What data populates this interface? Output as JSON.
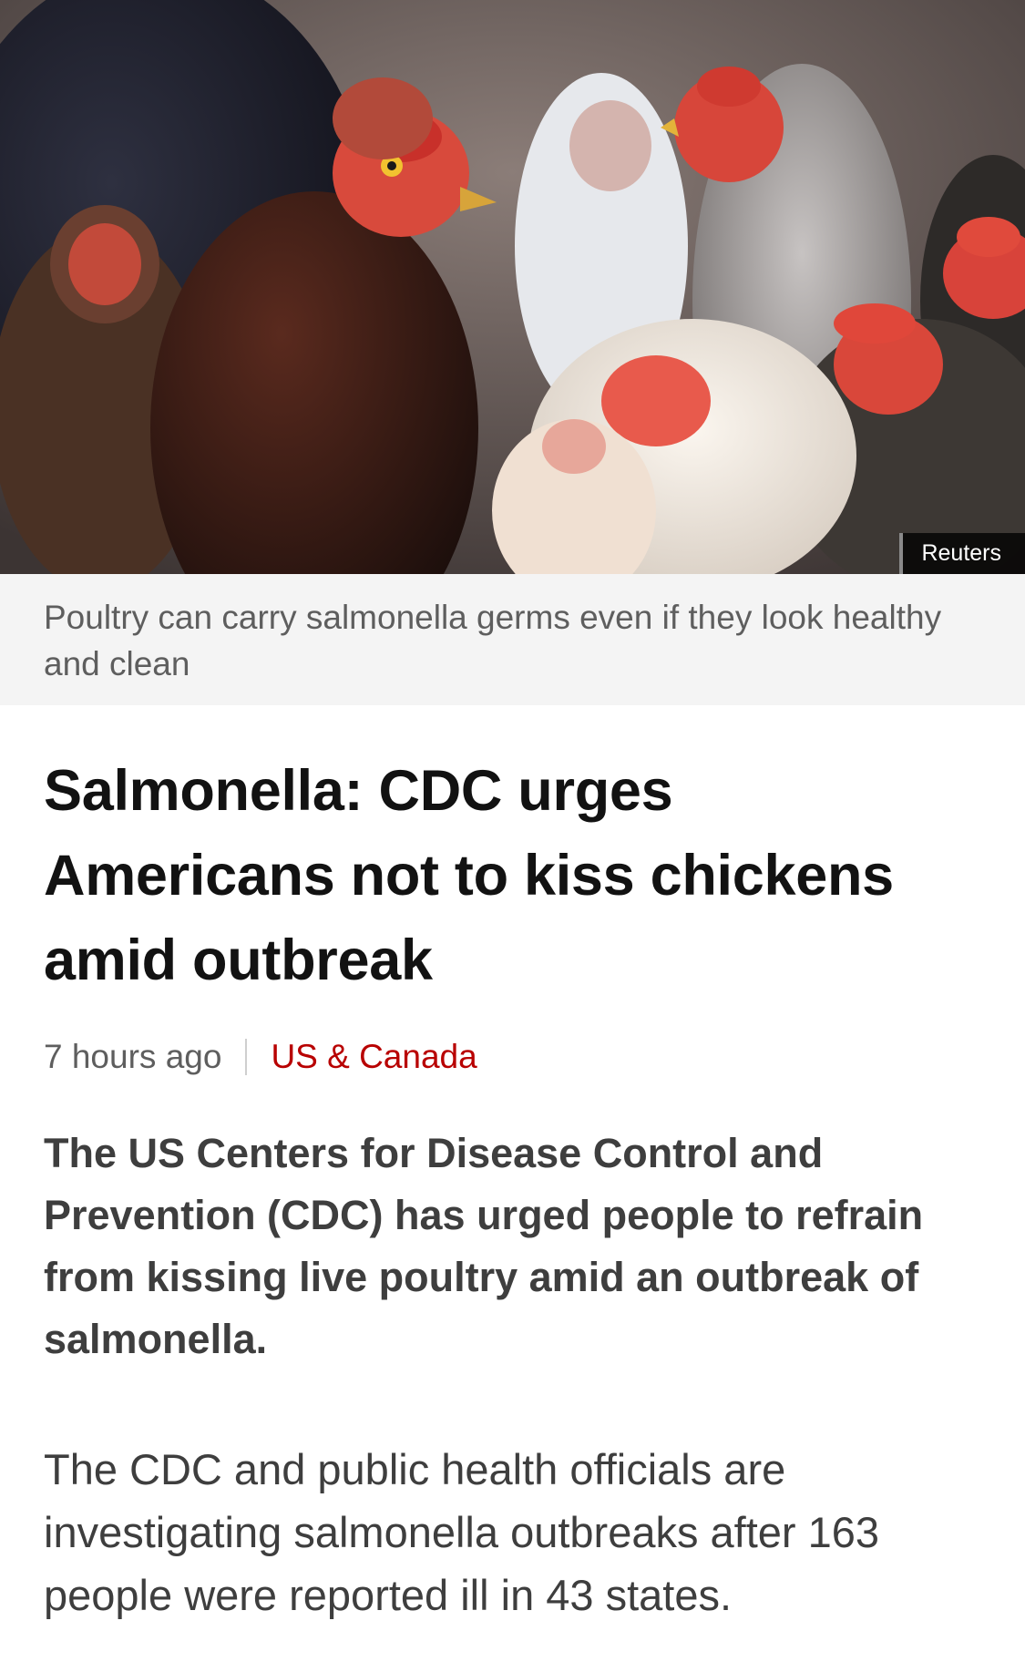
{
  "hero": {
    "image_subject": "chickens",
    "credit": "Reuters"
  },
  "caption": "Poultry can carry salmonella germs even if they look healthy and clean",
  "headline": "Salmonella: CDC urges Americans not to kiss chickens amid outbreak",
  "meta": {
    "time": "7 hours ago",
    "section": "US & Canada"
  },
  "article": {
    "lead": "The US Centers for Disease Control and Prevention (CDC) has urged people to refrain from kissing live poultry amid an outbreak of salmonella.",
    "paragraph_1": "The CDC and public health officials are investigating salmonella outbreaks after 163 people were reported ill in 43 states."
  },
  "colors": {
    "section_link": "#b80000",
    "caption_bg": "#f4f4f4",
    "headline": "#121212",
    "body_text": "#3e3e3e"
  }
}
